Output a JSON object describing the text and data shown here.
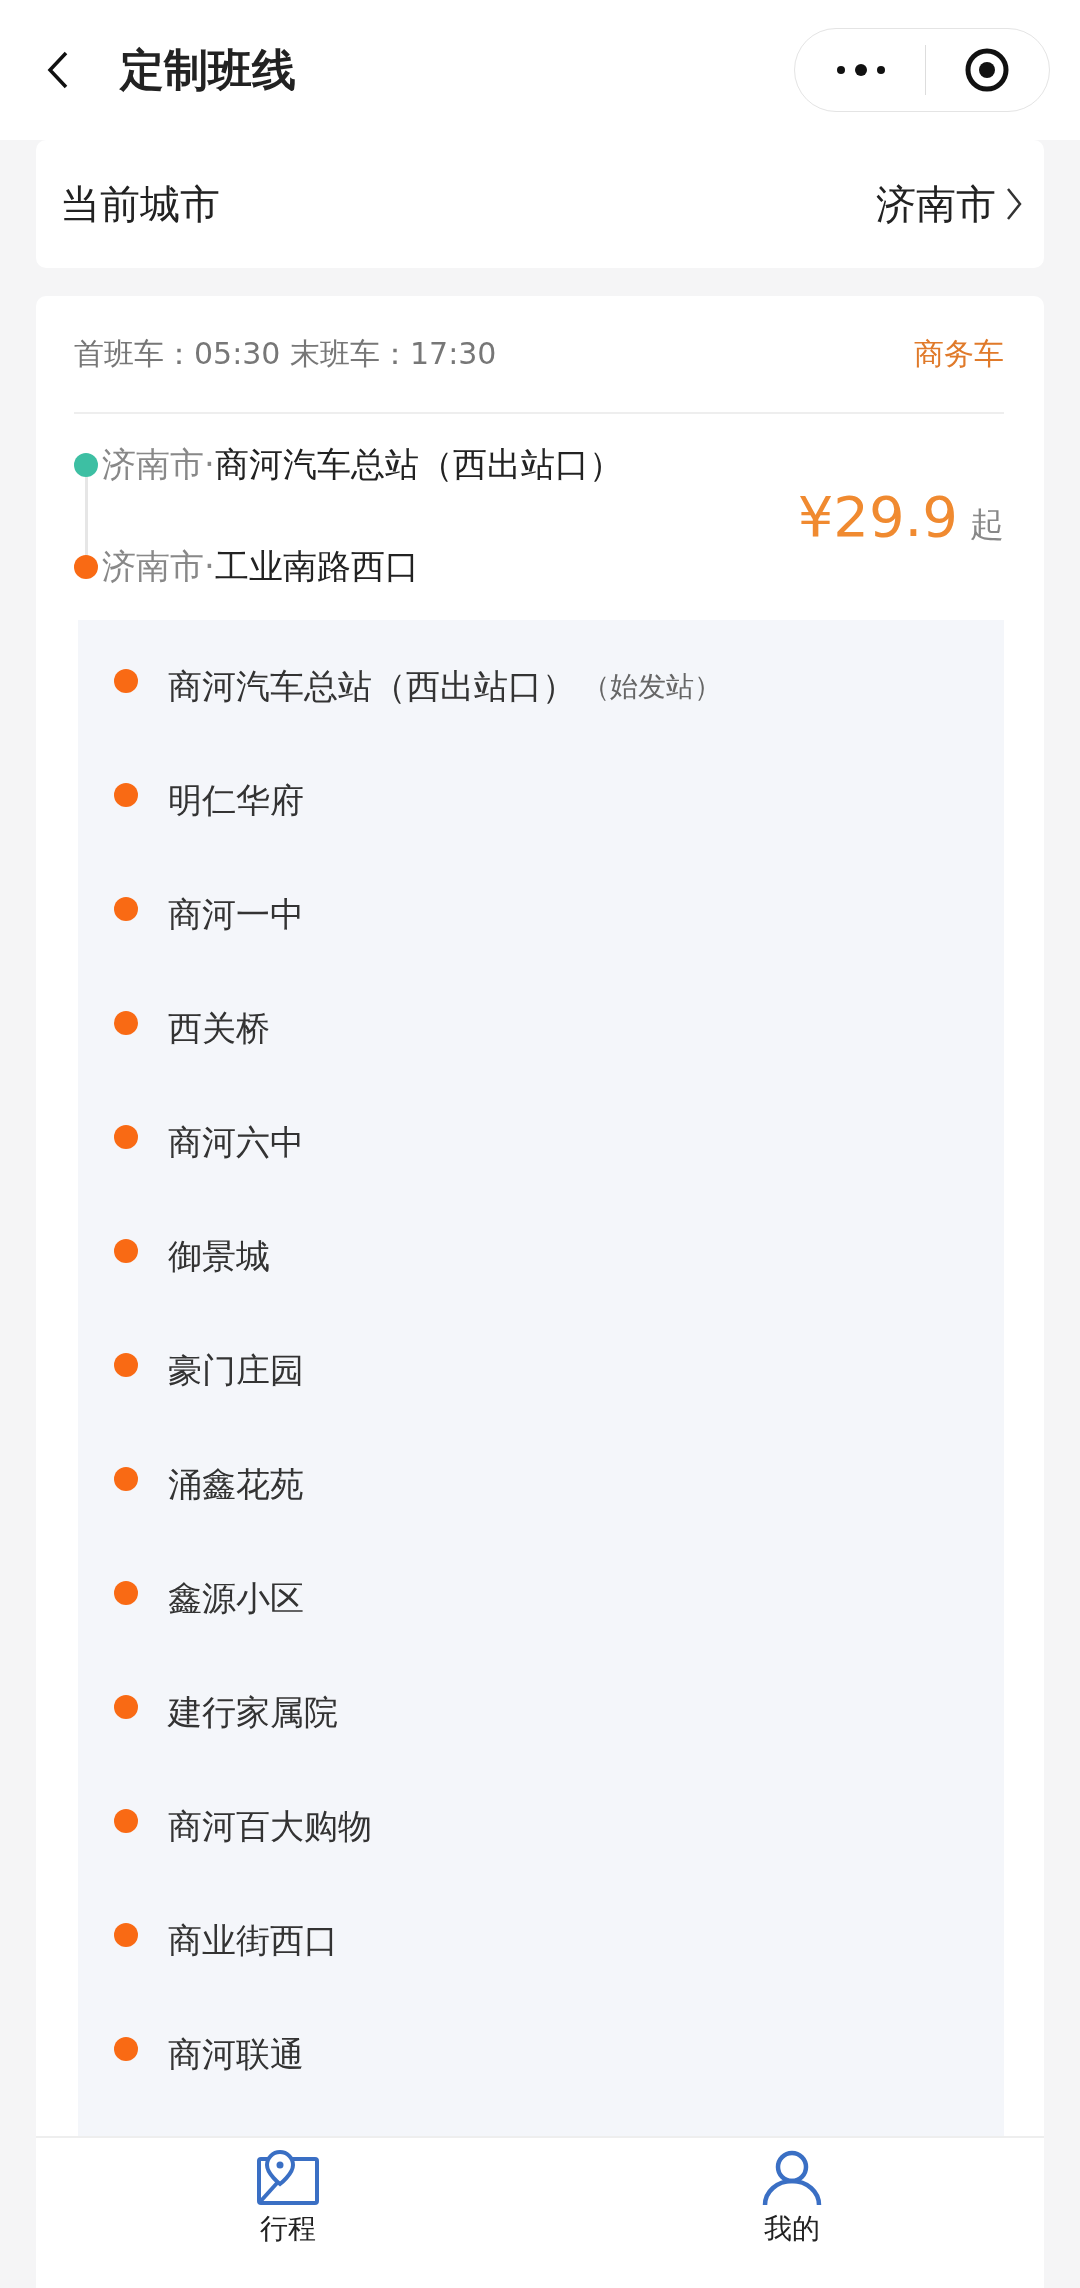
{
  "header": {
    "title": "定制班线"
  },
  "city": {
    "label": "当前城市",
    "value": "济南市"
  },
  "route": {
    "schedule": "首班车：05:30 末班车：17:30",
    "vehicle_type": "商务车",
    "origin": {
      "city": "济南市·",
      "station": "商河汽车总站（西出站口）",
      "color": "#3dbfa3"
    },
    "destination": {
      "city": "济南市·",
      "station": "工业南路西口",
      "color": "#f96a14"
    },
    "price": "¥29.9",
    "price_suffix": "起"
  },
  "stops": [
    {
      "name": "商河汽车总站（西出站口）",
      "note": "（始发站）"
    },
    {
      "name": "明仁华府"
    },
    {
      "name": "商河一中"
    },
    {
      "name": "西关桥"
    },
    {
      "name": "商河六中"
    },
    {
      "name": "御景城"
    },
    {
      "name": "豪门庄园"
    },
    {
      "name": "涌鑫花苑"
    },
    {
      "name": "鑫源小区"
    },
    {
      "name": "建行家属院"
    },
    {
      "name": "商河百大购物"
    },
    {
      "name": "商业街西口"
    },
    {
      "name": "商河联通"
    }
  ],
  "tab_bar": [
    {
      "label": "行程",
      "kind": "trips"
    },
    {
      "label": "我的",
      "kind": "profile"
    }
  ]
}
